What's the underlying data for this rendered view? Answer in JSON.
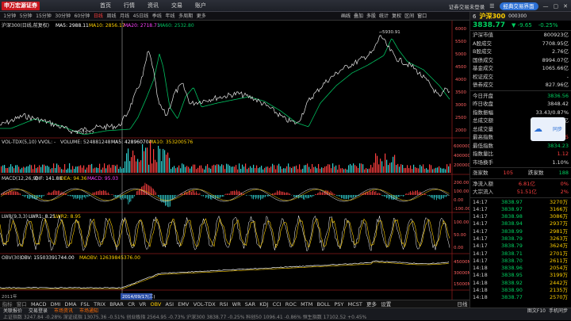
{
  "app": {
    "logo": "申万宏源证券"
  },
  "topnav": [
    "首页",
    "行情",
    "资讯",
    "交易",
    "账户"
  ],
  "topright": {
    "login": "证券交易未登录",
    "pill": "经典交易界面"
  },
  "periods": [
    "1分钟",
    "5分钟",
    "15分钟",
    "30分钟",
    "60分钟",
    "日线",
    "周线",
    "月线",
    "45日线",
    "季线",
    "年线",
    "多周期",
    "更多"
  ],
  "active_period": "日线",
  "toolbar": [
    "画线",
    "叠加",
    "多股",
    "统计",
    "复权",
    "区间",
    "窗口"
  ],
  "chart_titles": {
    "main": "沪深300(日线,前复权)",
    "ma5": "MA5: 2988.11",
    "ma10": "MA10: 2856.17",
    "ma20": "MA20: 2718.71",
    "ma60": "MA60: 2532.80",
    "vol": "VOL-TDX(5,10) VVOL: -",
    "volume": "VOLUME: 524881248",
    "vma5": "MA5: 428960704",
    "vma10": "MA10: 353200576",
    "macd": "MACD(12,26,9)",
    "dif": "DIF: 141.88",
    "dea": "DEA: 94.36",
    "macdv": "MACD: 95.03",
    "lwr": "LWR(9,3,3)",
    "lwr1": "LWR1: 8.25",
    "lwr2": "LWR2: 8.95",
    "obv": "OBV(30)",
    "obvv": "OBV: 15503391744.00",
    "maobv": "MAOBV: 12639845376.00"
  },
  "annotations": {
    "high": "5930.91",
    "low": "2023.17",
    "date": "2014/09/17(三)",
    "year_left": "2011年"
  },
  "right_axis": {
    "main": [
      "6000",
      "5500",
      "5000",
      "4500",
      "4000",
      "3500",
      "3000",
      "2500",
      "2000"
    ],
    "vol": [
      "600000",
      "400000",
      "200000"
    ],
    "macd": [
      "200.00",
      "100.00",
      "0.00",
      "-100.00"
    ],
    "lwr": [
      "100.00",
      "50.00",
      "0.00"
    ],
    "obv": [
      "45000M",
      "30000M",
      "15000M"
    ]
  },
  "bottom_tabs": [
    "MACD",
    "DMI",
    "DMA",
    "FSL",
    "TRIX",
    "BRAR",
    "CR",
    "VR",
    "OBV",
    "ASI",
    "EMV",
    "VOL-TDX",
    "RSI",
    "WR",
    "SAR",
    "KDJ",
    "CCI",
    "ROC",
    "MTM",
    "BOLL",
    "PSY",
    "MCST",
    "更多",
    "设置"
  ],
  "bottom_tabs_active": "OBV",
  "bottom_tabs_lead": [
    "指标",
    "窗口"
  ],
  "bottom_right": "日线",
  "status_tabs": [
    "关联报价",
    "交易登录",
    "市场资讯",
    "市场通知"
  ],
  "status_right": [
    "图文F10",
    "手机同步"
  ],
  "ticker": "上证指数 3247.84 -0.28%  深证成指 13075.36 -0.51%  创业板指 2564.95 -0.73%  沪深300 3838.77 -0.25%  科创50 1096.41 -0.86%  恒生指数 17102.52 +0.45%",
  "quote": {
    "index_no": "6",
    "name": "沪深300",
    "code": "000300",
    "price": "3838.77",
    "change": "▼ -9.65",
    "pct": "-0.25%",
    "stats1": [
      {
        "k": "沪深市值",
        "v": "800923亿",
        "cls": ""
      },
      {
        "k": "A股成交",
        "v": "7708.95亿",
        "cls": ""
      },
      {
        "k": "B股成交",
        "v": "2.76亿",
        "cls": ""
      },
      {
        "k": "国债成交",
        "v": "8994.07亿",
        "cls": ""
      },
      {
        "k": "基金成交",
        "v": "1065.66亿",
        "cls": ""
      },
      {
        "k": "权证成交",
        "v": "-",
        "cls": ""
      },
      {
        "k": "债券成交",
        "v": "827.96亿",
        "cls": ""
      }
    ],
    "stats2": [
      {
        "k": "今日开盘",
        "v": "3836.56",
        "cls": "g"
      },
      {
        "k": "昨日收盘",
        "v": "3848.42",
        "cls": ""
      },
      {
        "k": "指数振幅",
        "v": "33.43/0.87%",
        "cls": ""
      },
      {
        "k": "总成交额",
        "v": "2064.86亿",
        "cls": ""
      },
      {
        "k": "总成交量",
        "v": "",
        "cls": ""
      },
      {
        "k": "最高指数",
        "v": "3867.15",
        "cls": "r"
      },
      {
        "k": "最低指数",
        "v": "3834.23",
        "cls": "g"
      },
      {
        "k": "指数量比",
        "v": "1.12",
        "cls": "r"
      },
      {
        "k": "市场换手",
        "v": "1.10%",
        "cls": ""
      }
    ],
    "updown": {
      "k1": "涨家数",
      "v1": "105",
      "k2": "跌家数",
      "v2": "188"
    },
    "flows": [
      {
        "k": "净流入额",
        "v": "6.81亿",
        "p": "0%"
      },
      {
        "k": "大宗流入",
        "v": "51.51亿",
        "p": "2%"
      }
    ],
    "ticks": [
      {
        "t": "14:17",
        "p": "3838.97",
        "v": "3270万"
      },
      {
        "t": "14:17",
        "p": "3838.97",
        "v": "3166万"
      },
      {
        "t": "14:17",
        "p": "3838.98",
        "v": "3086万"
      },
      {
        "t": "14:17",
        "p": "3838.94",
        "v": "2937万"
      },
      {
        "t": "14:17",
        "p": "3838.99",
        "v": "2981万"
      },
      {
        "t": "14:17",
        "p": "3838.79",
        "v": "3263万"
      },
      {
        "t": "14:17",
        "p": "3838.79",
        "v": "3624万"
      },
      {
        "t": "14:17",
        "p": "3838.71",
        "v": "2701万"
      },
      {
        "t": "14:17",
        "p": "3838.70",
        "v": "2611万"
      },
      {
        "t": "14:18",
        "p": "3838.96",
        "v": "2054万"
      },
      {
        "t": "14:18",
        "p": "3838.95",
        "v": "3199万"
      },
      {
        "t": "14:18",
        "p": "3838.92",
        "v": "2442万"
      },
      {
        "t": "14:18",
        "p": "3838.90",
        "v": "2135万"
      },
      {
        "t": "14:18",
        "p": "3838.77",
        "v": "2570万"
      }
    ]
  },
  "cloud": {
    "label": "同步"
  },
  "colors": {
    "up": "#ff4040",
    "down": "#00d060",
    "price": "#e8e8e8",
    "ma5": "#ffffff",
    "ma10": "#ffd000",
    "ma20": "#ff40ff",
    "ma60": "#00c060"
  }
}
